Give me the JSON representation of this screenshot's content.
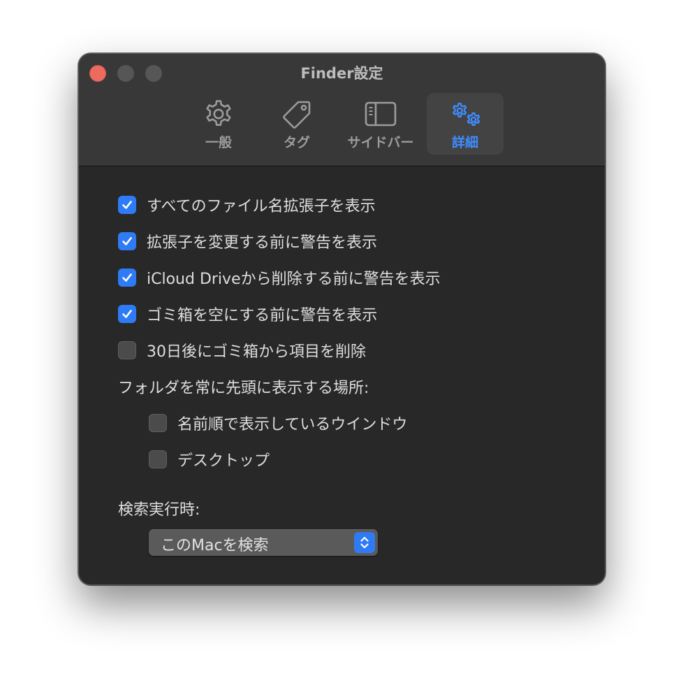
{
  "window": {
    "title": "Finder設定"
  },
  "toolbar": {
    "tabs": [
      {
        "label": "一般",
        "icon": "gear-icon",
        "active": false
      },
      {
        "label": "タグ",
        "icon": "tag-icon",
        "active": false
      },
      {
        "label": "サイドバー",
        "icon": "sidebar-icon",
        "active": false
      },
      {
        "label": "詳細",
        "icon": "gears-icon",
        "active": true
      }
    ]
  },
  "options": [
    {
      "label": "すべてのファイル名拡張子を表示",
      "checked": true
    },
    {
      "label": "拡張子を変更する前に警告を表示",
      "checked": true
    },
    {
      "label": "iCloud Driveから削除する前に警告を表示",
      "checked": true
    },
    {
      "label": "ゴミ箱を空にする前に警告を表示",
      "checked": true
    },
    {
      "label": "30日後にゴミ箱から項目を削除",
      "checked": false
    }
  ],
  "folders_on_top": {
    "label": "フォルダを常に先頭に表示する場所:",
    "options": [
      {
        "label": "名前順で表示しているウインドウ",
        "checked": false
      },
      {
        "label": "デスクトップ",
        "checked": false
      }
    ]
  },
  "search": {
    "label": "検索実行時:",
    "selected": "このMacを検索"
  },
  "colors": {
    "accent": "#2f7bf5",
    "active_tab_text": "#3f8cff",
    "close_button": "#ed6a5e"
  }
}
